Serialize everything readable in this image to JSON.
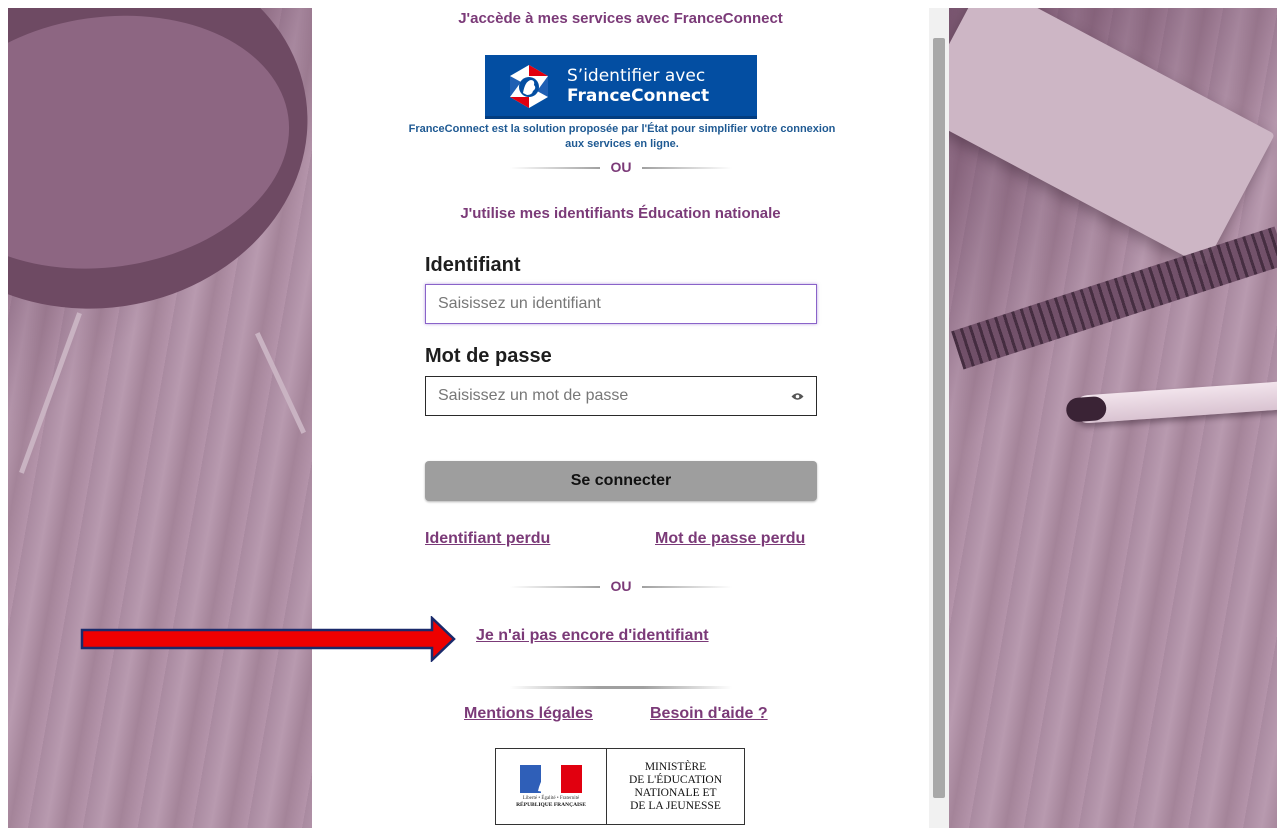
{
  "franceconnect": {
    "heading": "J'accède à mes services avec FranceConnect",
    "button_line1": "S’identifier avec",
    "button_line2": "FranceConnect",
    "description": "FranceConnect est la solution proposée par l'État pour simplifier votre connexion aux services en ligne."
  },
  "separators": {
    "or_top": "OU",
    "or_bottom": "OU"
  },
  "education": {
    "heading": "J'utilise mes identifiants Éducation nationale"
  },
  "login": {
    "username_label": "Identifiant",
    "username_placeholder": "Saisissez un identifiant",
    "username_value": "",
    "password_label": "Mot de passe",
    "password_placeholder": "Saisissez un mot de passe",
    "password_value": "",
    "submit_label": "Se connecter"
  },
  "links": {
    "lost_username": "Identifiant perdu",
    "lost_password": "Mot de passe perdu",
    "no_account": "Je n'ai pas encore d'identifiant",
    "legal": "Mentions légales",
    "help": "Besoin d'aide ?"
  },
  "ministry": {
    "line1": "MINISTÈRE",
    "line2": "DE L'ÉDUCATION",
    "line3": "NATIONALE ET",
    "line4": "DE LA JEUNESSE",
    "motto": "Liberté • Égalité • Fraternité",
    "republic": "RÉPUBLIQUE FRANÇAISE"
  },
  "colors": {
    "accent": "#7b3a78",
    "franceconnect_blue": "#034ea2",
    "annotation_arrow": "#ee0000"
  },
  "icons": {
    "password_toggle": "eye-icon",
    "annotation": "red-arrow-icon"
  }
}
